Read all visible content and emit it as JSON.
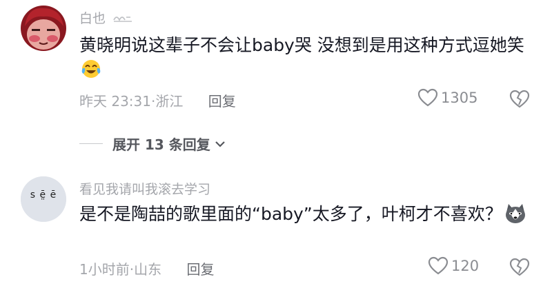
{
  "comments": [
    {
      "username": "白也",
      "content": "黄晓明说这辈子不会让baby哭 没想到是用这种方式逗她笑",
      "time_location": "昨天 23:31·浙江",
      "reply_label": "回复",
      "like_count": "1305"
    },
    {
      "username": "看见我请叫我滚去学习",
      "content": "是不是陶喆的歌里面的“baby”太多了，叶柯才不喜欢？",
      "time_location": "1小时前·山东",
      "reply_label": "回复",
      "like_count": "120",
      "avatar_text": "s ē̤ ē"
    }
  ],
  "expand_replies": {
    "label": "展开 13 条回复"
  },
  "icons": {
    "like": "heart-icon",
    "dislike": "broken-heart-icon",
    "expand": "chevron-down-icon",
    "emoji1": "laughing-crying-emoji",
    "emoji2": "husky-dog-emoji",
    "badge": "wave-badge-icon"
  },
  "colors": {
    "text_primary": "#161823",
    "text_secondary": "#a4a6ab",
    "accent_red": "#d8232a"
  }
}
